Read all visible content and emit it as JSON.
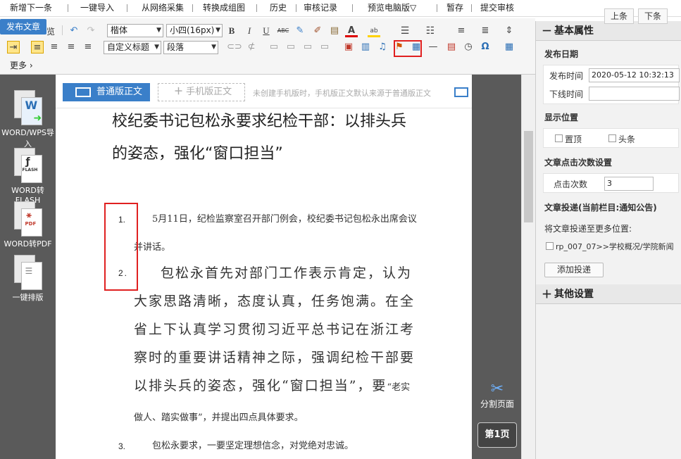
{
  "topbar": {
    "buttons": [
      "新增下一条",
      "一键导入",
      "从网络采集",
      "转换成组图",
      "历史",
      "审核记录",
      "预览电脑版▽",
      "暂存",
      "提交审核"
    ]
  },
  "publish_tab": "发布文章",
  "toolbar": {
    "preview_tail": "览",
    "font_family": "楷体",
    "font_size": "小四(16px)",
    "heading_style": "自定义标题",
    "paragraph_style": "段落",
    "more_label": "更多",
    "icons": [
      "undo-icon",
      "redo-icon",
      "bold-icon",
      "italic-icon",
      "underline-icon",
      "strikethrough-icon",
      "clear-format-icon",
      "format-painter-icon",
      "paste-icon",
      "font-color-icon",
      "highlight-icon",
      "ordered-list-icon",
      "unordered-list-icon",
      "line-height-icon",
      "paragraph-spacing-icon",
      "letter-spacing-icon",
      "table-icon"
    ]
  },
  "left_rail": {
    "items": [
      {
        "label": "WORD/WPS导入",
        "badge": "W"
      },
      {
        "label": "WORD转FLASH",
        "badge": "FLASH"
      },
      {
        "label": "WORD转PDF",
        "badge": "PDF"
      },
      {
        "label": "一键排版",
        "badge": ""
      }
    ]
  },
  "paper": {
    "tab_normal": "普通版正文",
    "tab_mobile": "手机版正文",
    "mode_hint": "未创建手机版时，手机版正文默认来源于普通版正文",
    "title": "校纪委书记包松永要求纪检干部：以排头兵的姿态，强化“窗口担当”",
    "paragraphs": [
      {
        "num": "1.",
        "text": "5月11日，纪检监察室召开部门例会，校纪委书记包松永出席会议并讲话。"
      },
      {
        "num": "2.",
        "text_large": "包松永首先对部门工作表示肯定，认为大家思路清晰，态度认真，任务饱满。在全省上下认真学习贯彻习近平总书记在浙江考察时的重要讲话精神之际，强调纪检干部要以排头兵的姿态，强化“窗口担当”，要",
        "text_small": "“老实做人、踏实做事”，并提出四点具体要求。"
      },
      {
        "num": "3.",
        "text": "包松永要求，一要坚定理想信念，对党绝对忠诚。"
      }
    ]
  },
  "editor_side": {
    "split_label": "分割页面",
    "page_label": "第1页"
  },
  "right_panel": {
    "prev": "上条",
    "next": "下条",
    "basic_title": "基本属性",
    "publish_date_label": "发布日期",
    "publish_time_label": "发布时间",
    "publish_time_value": "2020-05-12 10:32:13",
    "offline_time_label": "下线时间",
    "offline_time_value": "",
    "display_pos_label": "显示位置",
    "pin_label": "置顶",
    "headline_label": "头条",
    "click_settings_label": "文章点击次数设置",
    "click_count_label": "点击次数",
    "click_count_value": "3",
    "delivery_label": "文章投递(当前栏目:通知公告)",
    "delivery_more_label": "将文章投递至更多位置:",
    "delivery_option": "rp_007_07>>学校概况/学院新闻",
    "add_delivery": "添加投递",
    "other_title": "其他设置"
  },
  "colors": {
    "accent": "#3a7fc9",
    "highlight_box": "#e02020",
    "rail": "#5a5a5a"
  }
}
